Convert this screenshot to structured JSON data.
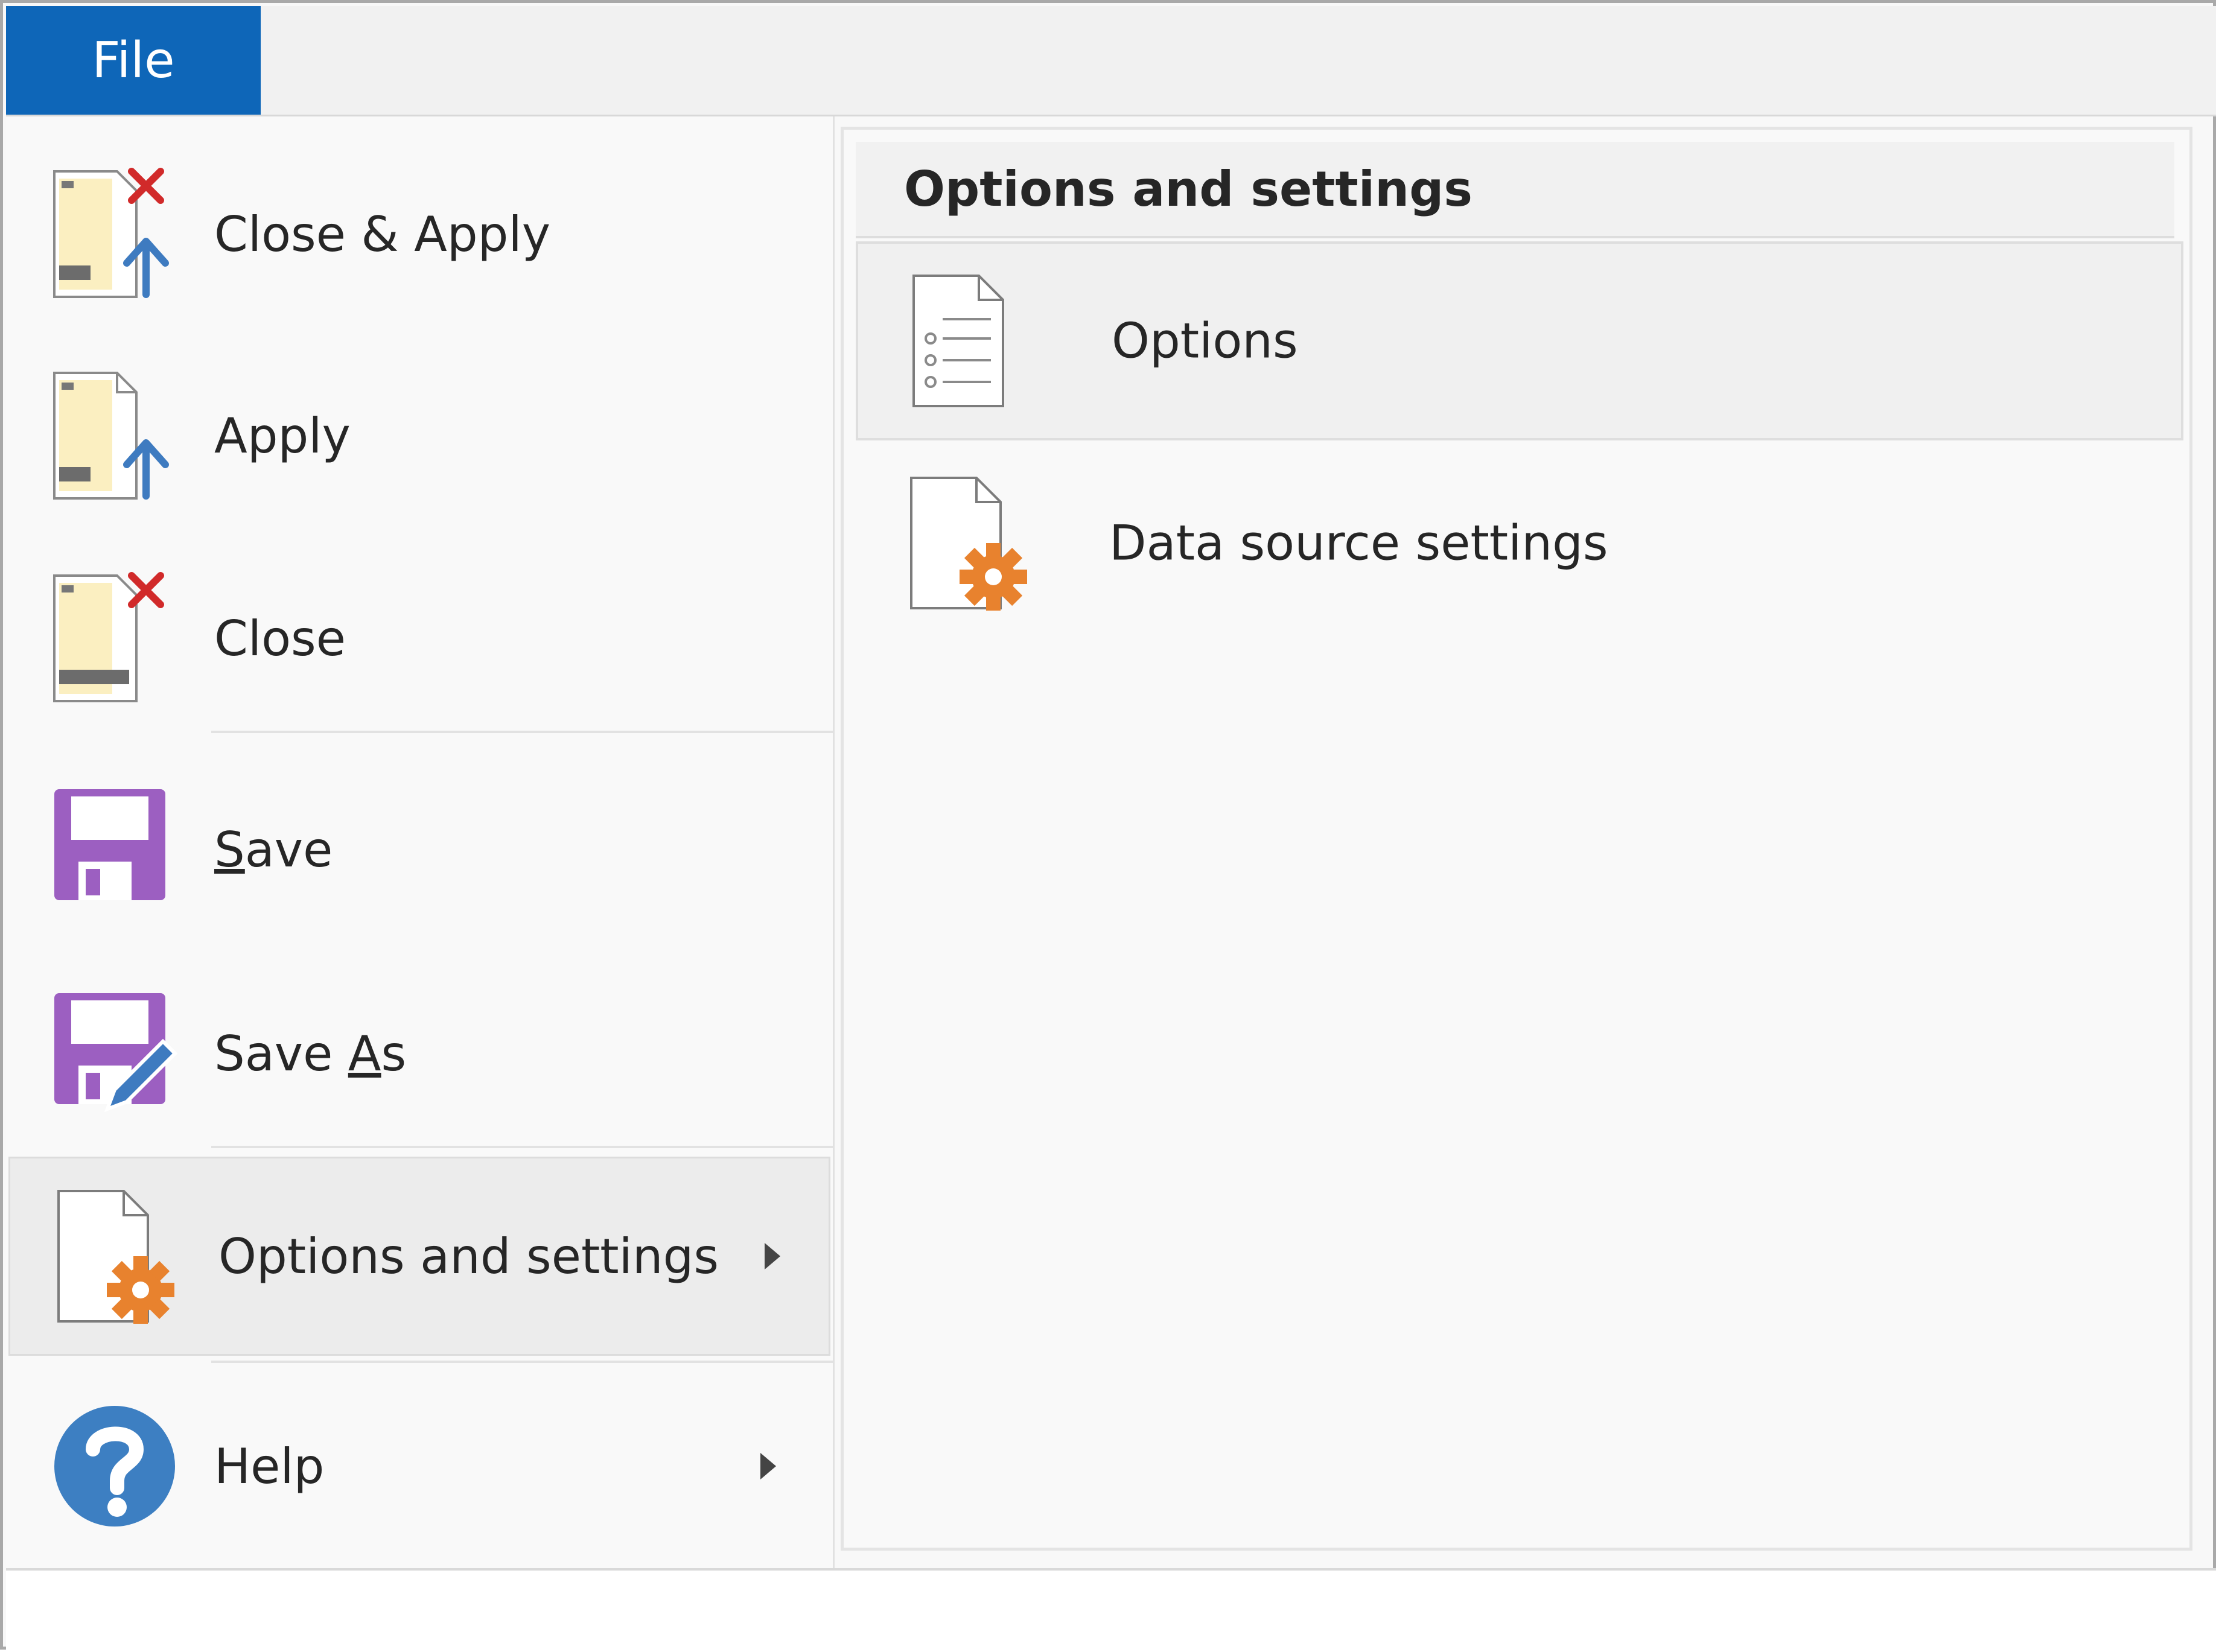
{
  "file_tab": {
    "label": "File"
  },
  "menu": {
    "items": [
      {
        "label": "Close & Apply",
        "icon": "close-apply-icon"
      },
      {
        "label": "Apply",
        "icon": "apply-icon"
      },
      {
        "label": "Close",
        "icon": "close-icon"
      },
      {
        "label_pre": "",
        "label_acc": "S",
        "label_post": "ave",
        "icon": "save-icon"
      },
      {
        "label_pre": "Save ",
        "label_acc": "A",
        "label_post": "s",
        "icon": "save-as-icon"
      },
      {
        "label": "Options and settings",
        "icon": "document-gear-icon",
        "selected": true
      },
      {
        "label": "Help",
        "icon": "help-icon"
      }
    ]
  },
  "submenu": {
    "header": "Options and settings",
    "items": [
      {
        "label": "Options",
        "icon": "options-list-icon",
        "selected": true
      },
      {
        "label": "Data source settings",
        "icon": "document-gear-icon"
      }
    ]
  },
  "colors": {
    "file_tab_bg": "#0e66b8",
    "save_purple": "#9c5fc1",
    "gear_orange": "#e8822e",
    "arrow_blue": "#3e7bc0",
    "close_red": "#d12a2a",
    "help_blue": "#3d7fc2"
  }
}
